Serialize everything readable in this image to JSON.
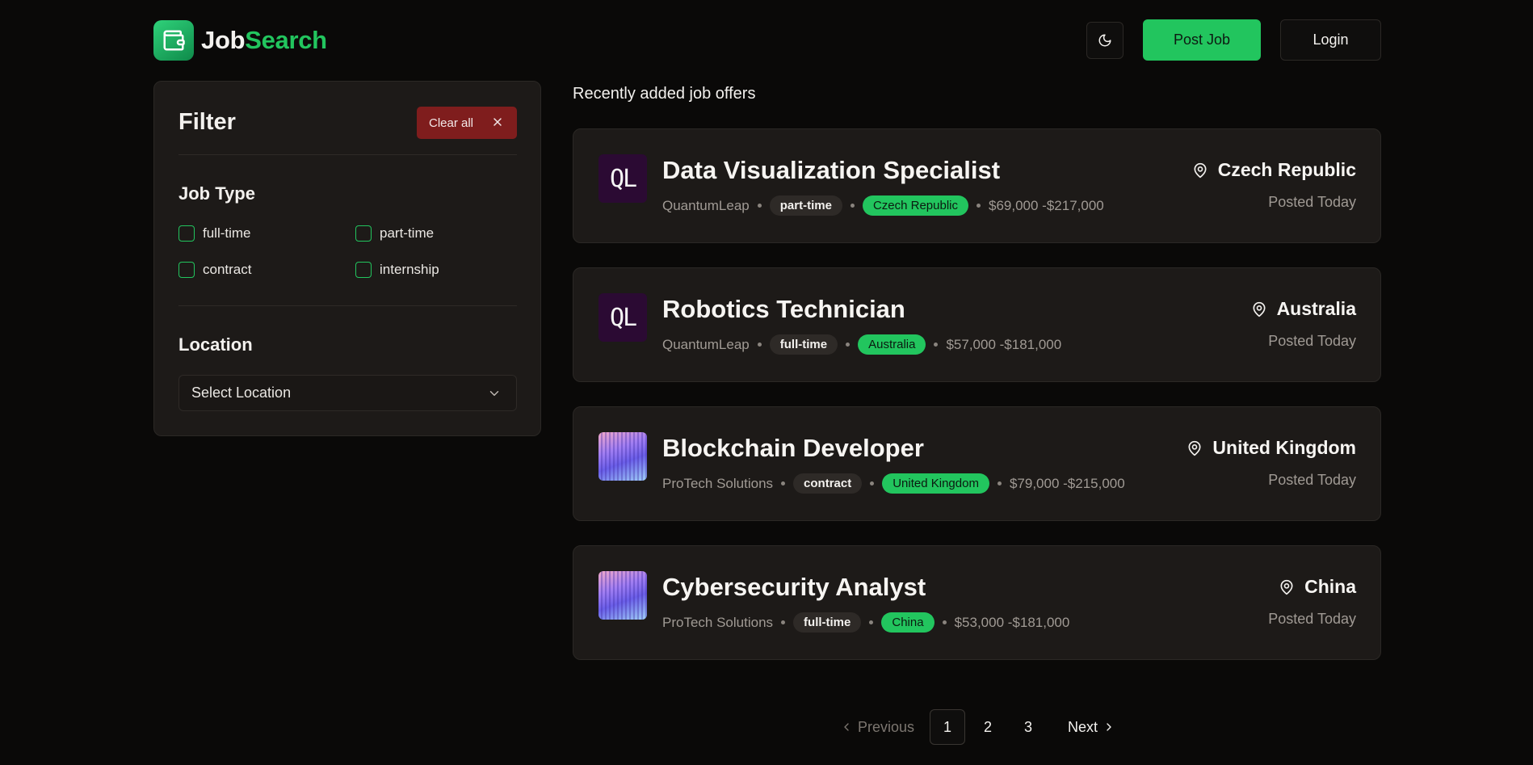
{
  "brand": {
    "part1": "Job",
    "part2": "Search"
  },
  "header": {
    "post_job": "Post Job",
    "login": "Login"
  },
  "filter": {
    "title": "Filter",
    "clear_all": "Clear all",
    "job_type_title": "Job Type",
    "job_types": [
      "full-time",
      "part-time",
      "contract",
      "internship"
    ],
    "location_title": "Location",
    "location_placeholder": "Select Location"
  },
  "list_heading": "Recently added job offers",
  "jobs": [
    {
      "title": "Data Visualization Specialist",
      "company": "QuantumLeap",
      "type": "part-time",
      "location": "Czech Republic",
      "salary": "$69,000 -$217,000",
      "posted": "Posted Today",
      "logo": "QL"
    },
    {
      "title": "Robotics Technician",
      "company": "QuantumLeap",
      "type": "full-time",
      "location": "Australia",
      "salary": "$57,000 -$181,000",
      "posted": "Posted Today",
      "logo": "QL"
    },
    {
      "title": "Blockchain Developer",
      "company": "ProTech Solutions",
      "type": "contract",
      "location": "United Kingdom",
      "salary": "$79,000 -$215,000",
      "posted": "Posted Today",
      "logo": "gradient-image"
    },
    {
      "title": "Cybersecurity Analyst",
      "company": "ProTech Solutions",
      "type": "full-time",
      "location": "China",
      "salary": "$53,000 -$181,000",
      "posted": "Posted Today",
      "logo": "gradient-image"
    }
  ],
  "pagination": {
    "previous": "Previous",
    "pages": [
      "1",
      "2",
      "3"
    ],
    "current": "1",
    "next": "Next"
  },
  "colors": {
    "accent": "#22c55e",
    "danger": "#7f1d1d",
    "card": "#1d1a18",
    "background": "#0a0908"
  }
}
